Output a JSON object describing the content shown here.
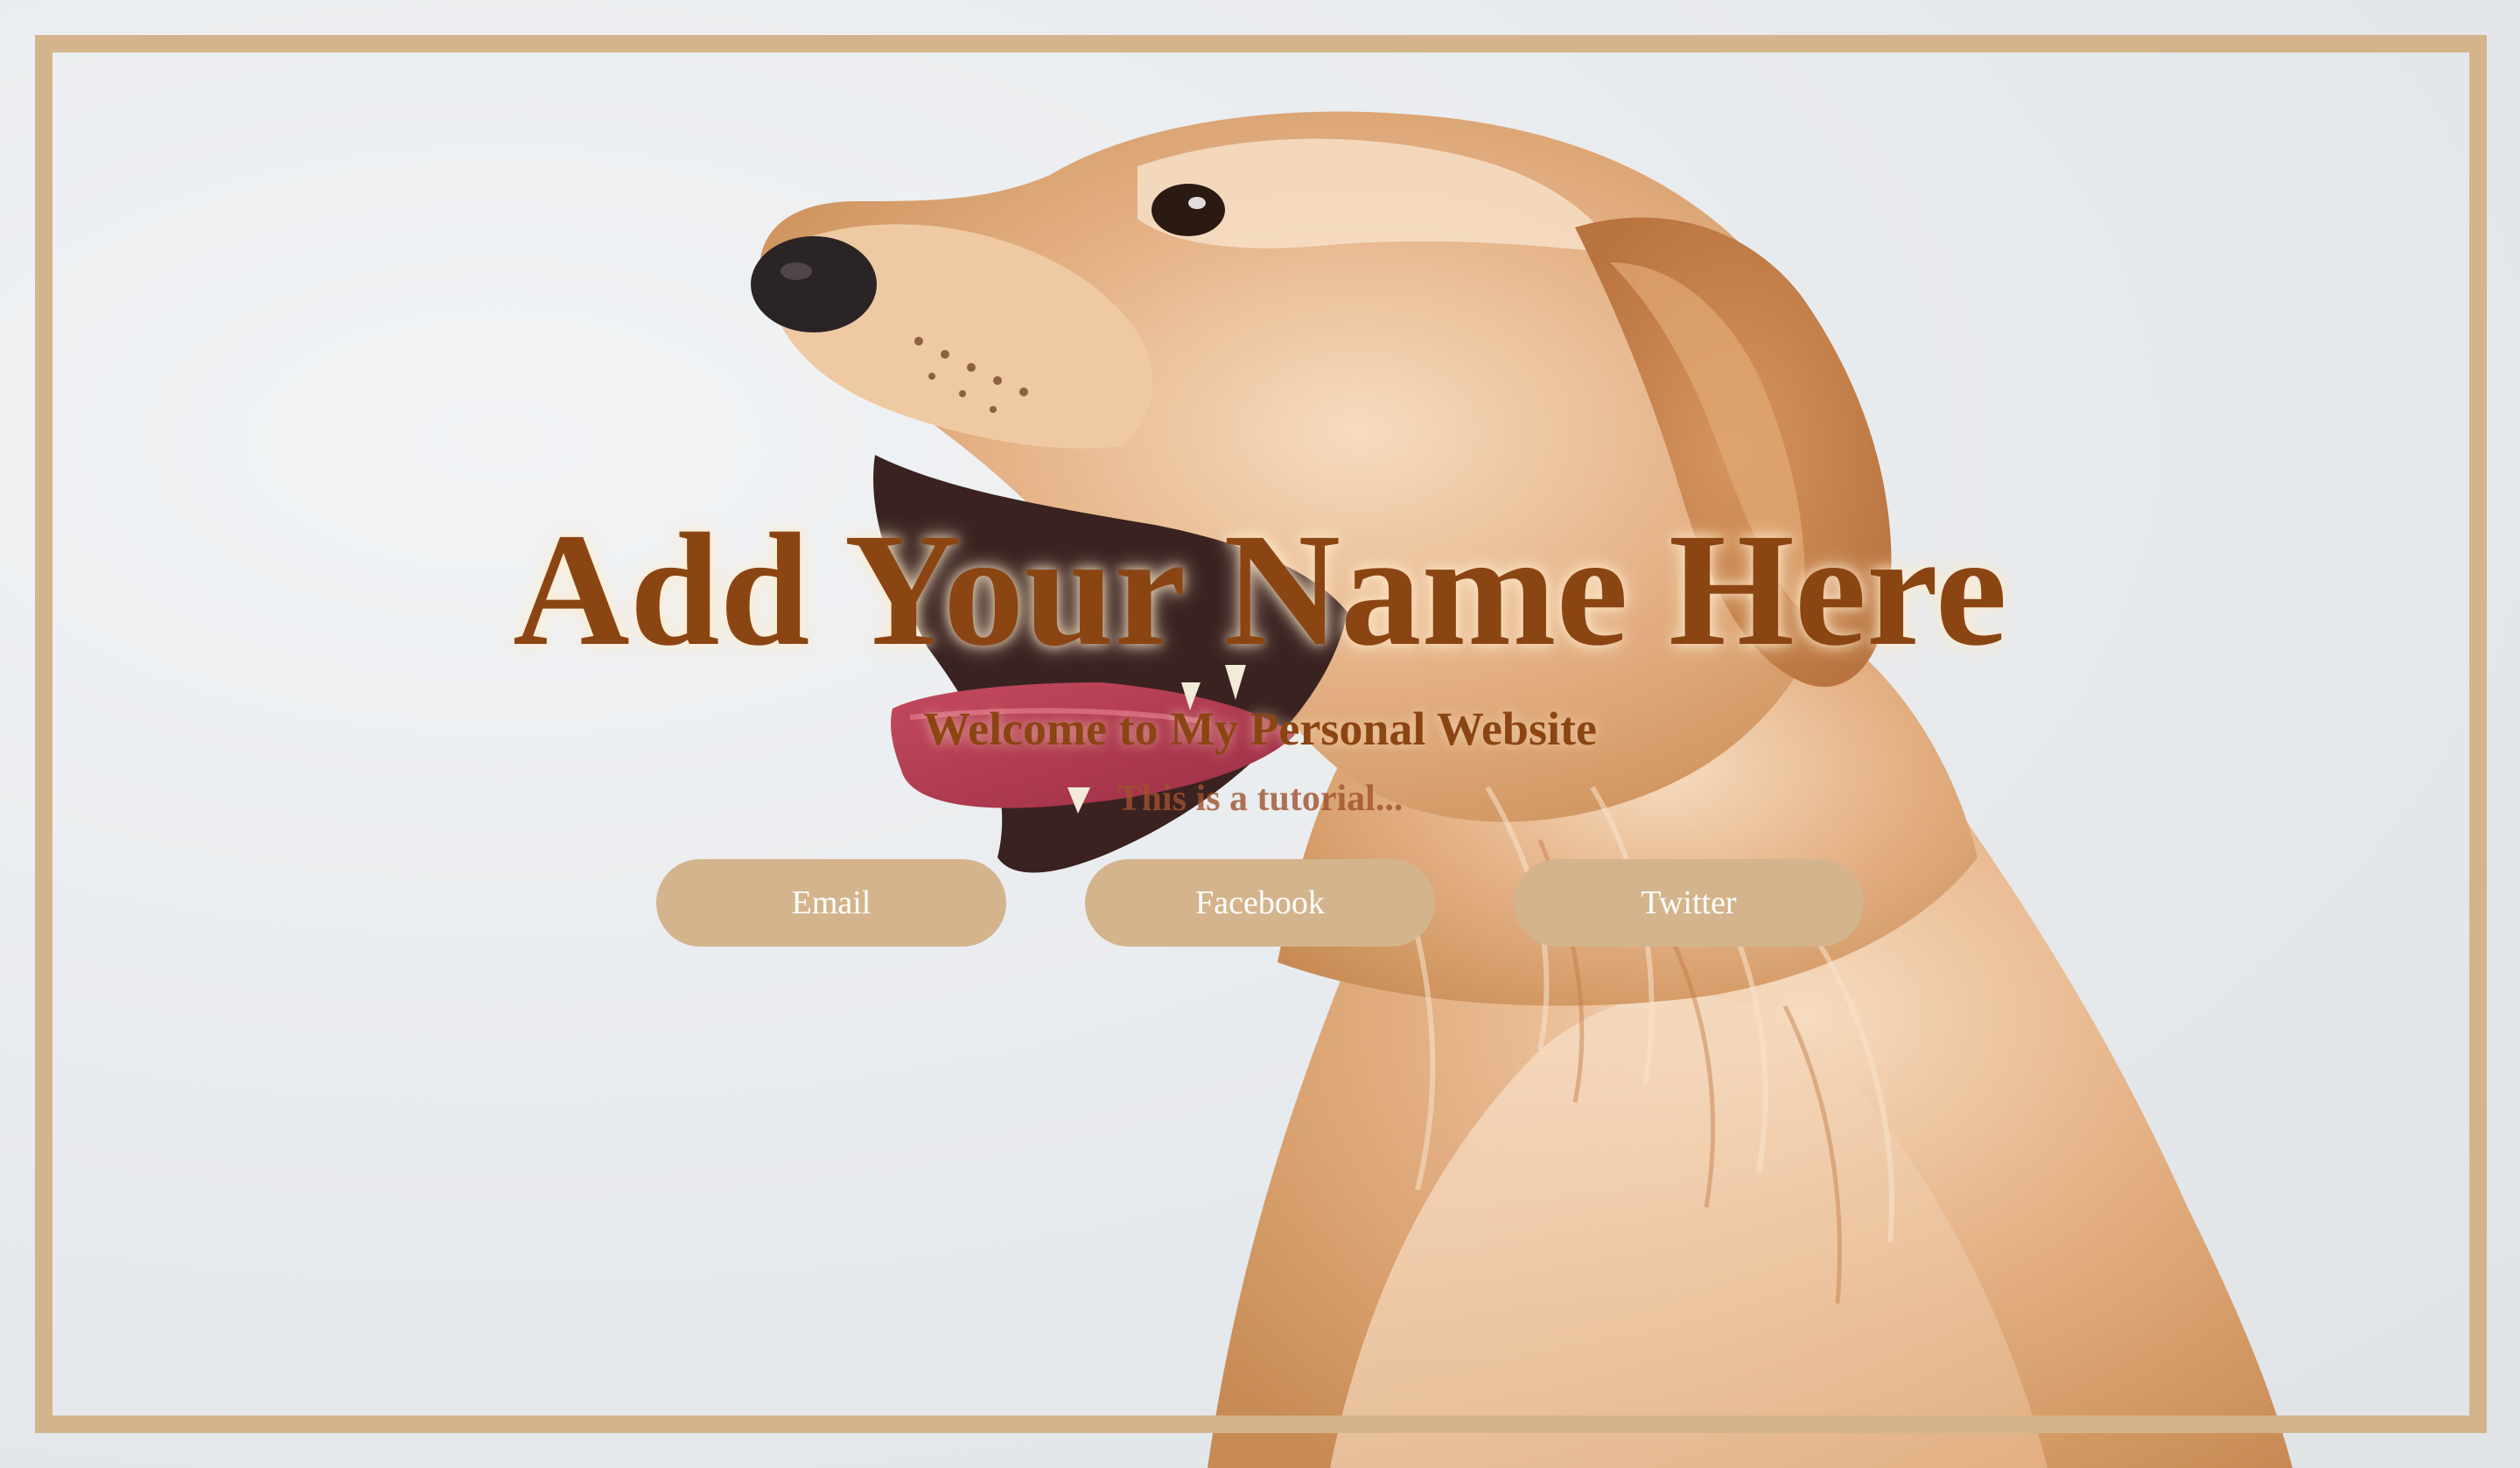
{
  "hero": {
    "title": "Add Your Name Here",
    "subtitle": "Welcome to My Personal Website",
    "tagline": "This is a tutorial..."
  },
  "buttons": {
    "email_label": "Email",
    "facebook_label": "Facebook",
    "twitter_label": "Twitter"
  },
  "colors": {
    "frame": "#d4b48c",
    "button_bg": "#d4b48c",
    "title_text": "#8b4513",
    "background": "#e8ebee"
  }
}
